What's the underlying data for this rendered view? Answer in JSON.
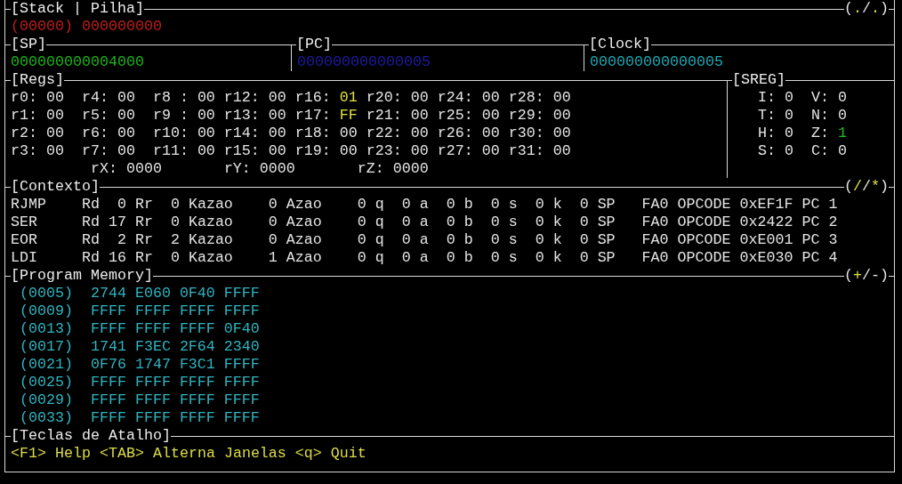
{
  "stack": {
    "title": "[Stack | Pilha]",
    "mark": [
      {
        "text": "(",
        "highlight": false
      },
      {
        "text": ".",
        "highlight": true
      },
      {
        "text": "/",
        "highlight": false
      },
      {
        "text": ".",
        "highlight": true
      },
      {
        "text": ")",
        "highlight": false
      }
    ],
    "index": "(00000)",
    "value": "000000000"
  },
  "counters": [
    {
      "title": "[SP]",
      "value": "000000000004000",
      "color": "#1cb41c"
    },
    {
      "title": "[PC]",
      "value": "000000000000005",
      "color": "#1c1ca4"
    },
    {
      "title": "[Clock]",
      "value": "000000000000005",
      "color": "#20a8b4"
    }
  ],
  "regs": {
    "title": "[Regs]",
    "rows": [
      [
        {
          "label": "r0:",
          "value": "00",
          "changed": false
        },
        {
          "label": "r4:",
          "value": "00",
          "changed": false
        },
        {
          "label": "r8 :",
          "value": "00",
          "changed": false
        },
        {
          "label": "r12:",
          "value": "00",
          "changed": false
        },
        {
          "label": "r16:",
          "value": "01",
          "changed": true
        },
        {
          "label": "r20:",
          "value": "00",
          "changed": false
        },
        {
          "label": "r24:",
          "value": "00",
          "changed": false
        },
        {
          "label": "r28:",
          "value": "00",
          "changed": false
        }
      ],
      [
        {
          "label": "r1:",
          "value": "00",
          "changed": false
        },
        {
          "label": "r5:",
          "value": "00",
          "changed": false
        },
        {
          "label": "r9 :",
          "value": "00",
          "changed": false
        },
        {
          "label": "r13:",
          "value": "00",
          "changed": false
        },
        {
          "label": "r17:",
          "value": "FF",
          "changed": true
        },
        {
          "label": "r21:",
          "value": "00",
          "changed": false
        },
        {
          "label": "r25:",
          "value": "00",
          "changed": false
        },
        {
          "label": "r29:",
          "value": "00",
          "changed": false
        }
      ],
      [
        {
          "label": "r2:",
          "value": "00",
          "changed": false
        },
        {
          "label": "r6:",
          "value": "00",
          "changed": false
        },
        {
          "label": "r10:",
          "value": "00",
          "changed": false
        },
        {
          "label": "r14:",
          "value": "00",
          "changed": false
        },
        {
          "label": "r18:",
          "value": "00",
          "changed": false
        },
        {
          "label": "r22:",
          "value": "00",
          "changed": false
        },
        {
          "label": "r26:",
          "value": "00",
          "changed": false
        },
        {
          "label": "r30:",
          "value": "00",
          "changed": false
        }
      ],
      [
        {
          "label": "r3:",
          "value": "00",
          "changed": false
        },
        {
          "label": "r7:",
          "value": "00",
          "changed": false
        },
        {
          "label": "r11:",
          "value": "00",
          "changed": false
        },
        {
          "label": "r15:",
          "value": "00",
          "changed": false
        },
        {
          "label": "r19:",
          "value": "00",
          "changed": false
        },
        {
          "label": "r23:",
          "value": "00",
          "changed": false
        },
        {
          "label": "r27:",
          "value": "00",
          "changed": false
        },
        {
          "label": "r31:",
          "value": "00",
          "changed": false
        }
      ]
    ],
    "pointers": [
      {
        "label": "rX:",
        "value": "0000"
      },
      {
        "label": "rY:",
        "value": "0000"
      },
      {
        "label": "rZ:",
        "value": "0000"
      }
    ]
  },
  "sreg": {
    "title": "[SREG]",
    "rows": [
      [
        {
          "name": "I:",
          "value": "0",
          "set": false
        },
        {
          "name": "V:",
          "value": "0",
          "set": false
        }
      ],
      [
        {
          "name": "T:",
          "value": "0",
          "set": false
        },
        {
          "name": "N:",
          "value": "0",
          "set": false
        }
      ],
      [
        {
          "name": "H:",
          "value": "0",
          "set": false
        },
        {
          "name": "Z:",
          "value": "1",
          "set": true
        }
      ],
      [
        {
          "name": "S:",
          "value": "0",
          "set": false
        },
        {
          "name": "C:",
          "value": "0",
          "set": false
        }
      ]
    ]
  },
  "context": {
    "title": "[Contexto]",
    "mark": [
      {
        "text": "(",
        "highlight": false
      },
      {
        "text": "/",
        "highlight": true
      },
      {
        "text": "/",
        "highlight": false
      },
      {
        "text": "*",
        "highlight": true
      },
      {
        "text": ")",
        "highlight": false
      }
    ],
    "rows": [
      {
        "mnemonic": "RJMP",
        "fields": [
          {
            "label": "Rd",
            "value": "0"
          },
          {
            "label": "Rr",
            "value": "0"
          },
          {
            "label": "Kazao",
            "value": "0"
          },
          {
            "label": "Azao",
            "value": "0"
          },
          {
            "label": "q",
            "value": "0"
          },
          {
            "label": "a",
            "value": "0"
          },
          {
            "label": "b",
            "value": "0"
          },
          {
            "label": "s",
            "value": "0"
          },
          {
            "label": "k",
            "value": "0"
          },
          {
            "label": "SP"
          },
          {
            "label": "FA0"
          },
          {
            "label": "OPCODE",
            "value": "0xEF1F"
          },
          {
            "label": "PC",
            "value": "1"
          }
        ]
      },
      {
        "mnemonic": "SER",
        "fields": [
          {
            "label": "Rd",
            "value": "17"
          },
          {
            "label": "Rr",
            "value": "0"
          },
          {
            "label": "Kazao",
            "value": "0"
          },
          {
            "label": "Azao",
            "value": "0"
          },
          {
            "label": "q",
            "value": "0"
          },
          {
            "label": "a",
            "value": "0"
          },
          {
            "label": "b",
            "value": "0"
          },
          {
            "label": "s",
            "value": "0"
          },
          {
            "label": "k",
            "value": "0"
          },
          {
            "label": "SP"
          },
          {
            "label": "FA0"
          },
          {
            "label": "OPCODE",
            "value": "0x2422"
          },
          {
            "label": "PC",
            "value": "2"
          }
        ]
      },
      {
        "mnemonic": "EOR",
        "fields": [
          {
            "label": "Rd",
            "value": "2"
          },
          {
            "label": "Rr",
            "value": "2"
          },
          {
            "label": "Kazao",
            "value": "0"
          },
          {
            "label": "Azao",
            "value": "0"
          },
          {
            "label": "q",
            "value": "0"
          },
          {
            "label": "a",
            "value": "0"
          },
          {
            "label": "b",
            "value": "0"
          },
          {
            "label": "s",
            "value": "0"
          },
          {
            "label": "k",
            "value": "0"
          },
          {
            "label": "SP"
          },
          {
            "label": "FA0"
          },
          {
            "label": "OPCODE",
            "value": "0xE001"
          },
          {
            "label": "PC",
            "value": "3"
          }
        ]
      },
      {
        "mnemonic": "LDI",
        "fields": [
          {
            "label": "Rd",
            "value": "16"
          },
          {
            "label": "Rr",
            "value": "0"
          },
          {
            "label": "Kazao",
            "value": "1"
          },
          {
            "label": "Azao",
            "value": "0"
          },
          {
            "label": "q",
            "value": "0"
          },
          {
            "label": "a",
            "value": "0"
          },
          {
            "label": "b",
            "value": "0"
          },
          {
            "label": "s",
            "value": "0"
          },
          {
            "label": "k",
            "value": "0"
          },
          {
            "label": "SP"
          },
          {
            "label": "FA0"
          },
          {
            "label": "OPCODE",
            "value": "0xE030"
          },
          {
            "label": "PC",
            "value": "4"
          }
        ]
      }
    ]
  },
  "program_memory": {
    "title": "[Program Memory]",
    "mark": [
      {
        "text": "(",
        "highlight": false
      },
      {
        "text": "+",
        "highlight": true
      },
      {
        "text": "/",
        "highlight": false
      },
      {
        "text": "-",
        "highlight": false
      },
      {
        "text": ")",
        "highlight": false
      }
    ],
    "rows": [
      {
        "address": "(0005)",
        "words": [
          "2744",
          "E060",
          "0F40",
          "FFFF"
        ]
      },
      {
        "address": "(0009)",
        "words": [
          "FFFF",
          "FFFF",
          "FFFF",
          "FFFF"
        ]
      },
      {
        "address": "(0013)",
        "words": [
          "FFFF",
          "FFFF",
          "FFFF",
          "0F40"
        ]
      },
      {
        "address": "(0017)",
        "words": [
          "1741",
          "F3EC",
          "2F64",
          "2340"
        ]
      },
      {
        "address": "(0021)",
        "words": [
          "0F76",
          "1747",
          "F3C1",
          "FFFF"
        ]
      },
      {
        "address": "(0025)",
        "words": [
          "FFFF",
          "FFFF",
          "FFFF",
          "FFFF"
        ]
      },
      {
        "address": "(0029)",
        "words": [
          "FFFF",
          "FFFF",
          "FFFF",
          "FFFF"
        ]
      },
      {
        "address": "(0033)",
        "words": [
          "FFFF",
          "FFFF",
          "FFFF",
          "FFFF"
        ]
      }
    ]
  },
  "shortcuts": {
    "title": "[Teclas de Atalho]",
    "text": "<F1> Help <TAB> Alterna Janelas <q> Quit"
  }
}
